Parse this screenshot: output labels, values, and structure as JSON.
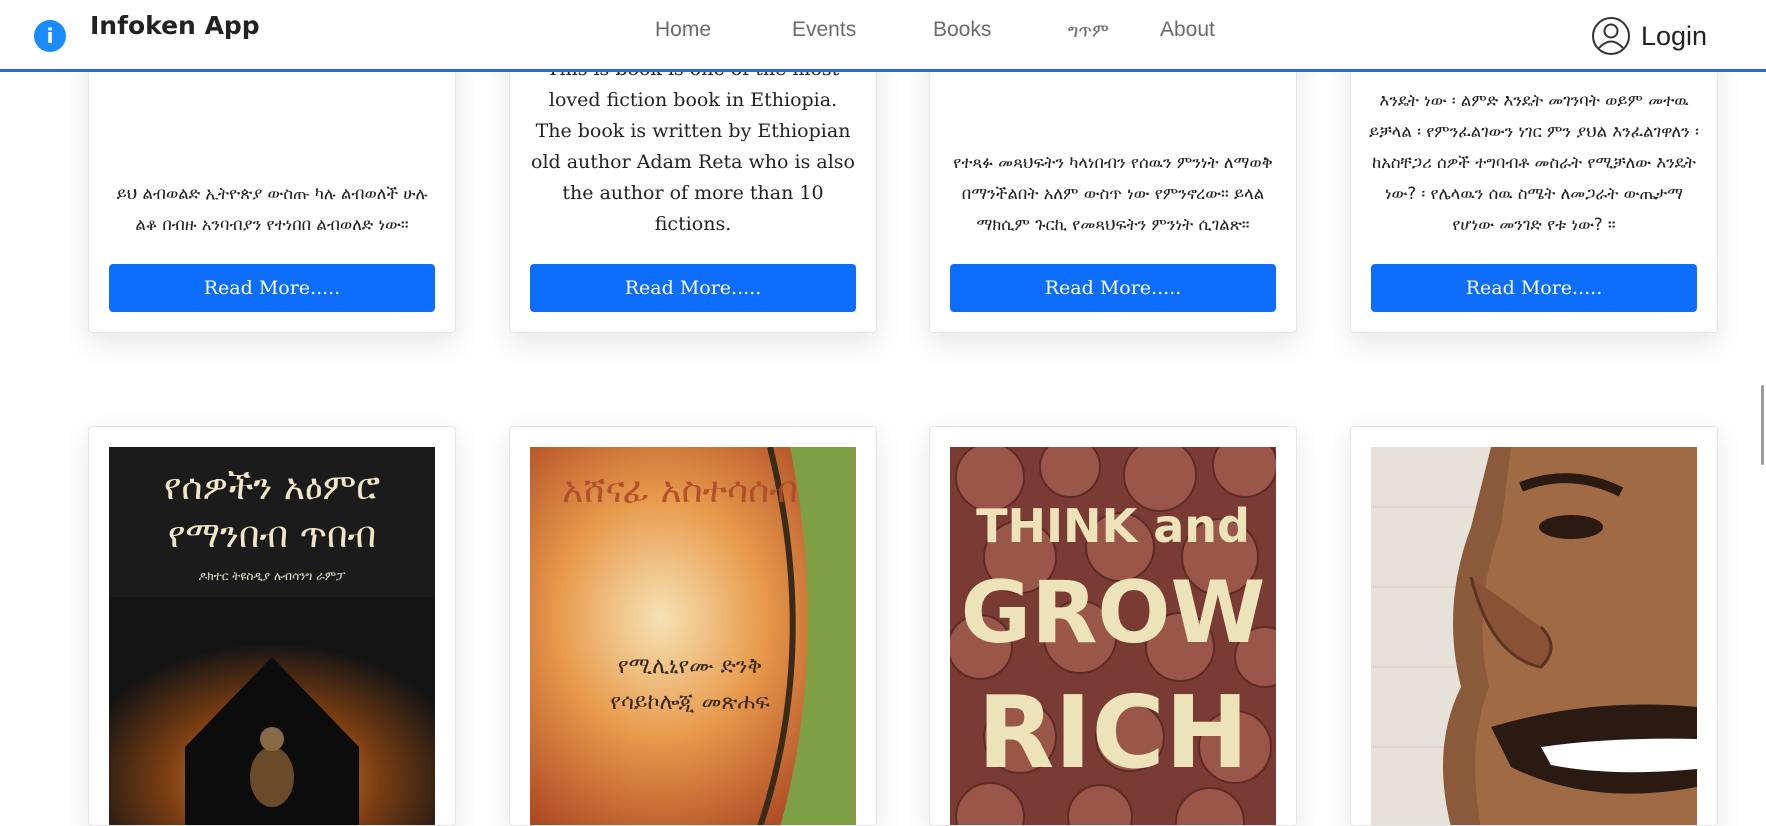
{
  "navbar": {
    "brand": "Infoken App",
    "links": [
      "Home",
      "Events",
      "Books",
      "ግጥም",
      "About"
    ],
    "login_label": "Login"
  },
  "colors": {
    "accent": "#0d6efd",
    "navbar_border": "#1f6fe0"
  },
  "row1_cards": [
    {
      "description": "ይህ ልብወልድ ኢትዮጵያ ውስጡ ካሉ ልብወለች ሁሉ ልቆ በብዙ አንባብያን የተነበበ ልብወለድ ነው።",
      "button_label": "Read More....."
    },
    {
      "description": "This is book is one of the most loved fiction book in Ethiopia. The book is written by Ethiopian old author Adam Reta who is also the author of more than 10 fictions.",
      "button_label": "Read More....."
    },
    {
      "description": "የተጻፉ መጻህፍትን ካላነበብን የሰዉን ምንነት ለማወቅ በማንችልበት አለም ውስጥ ነው የምንኖረው። ይላል ማክሲም ጉርኪ የመጻህፍትን ምንነት ሲገልጽ።",
      "button_label": "Read More....."
    },
    {
      "description": "እንዴት ነው ፡ ልምድ እንዴት መገንባት ወይም መተዉ ይቻላል ፡ የምንፈልገውን ነገር ምን ያህል እንፈልገዋለን ፡ ከአስቸጋሪ ሰዎች ተግባብቶ መስራት የሚቻለው እንዴት ነው? ፡ የሌላዉን ሰዉ ስሜት ለመጋራት ውጤታማ የሆነው መንገድ የቱ ነው? ።",
      "button_label": "Read More....."
    }
  ],
  "row2_cards": [
    {
      "cover_lines": [
        "የሰዎችን አዕምሮ",
        "የማንበብ ጥበብ"
      ],
      "cover_subtitle": "ዶክተር ትዩስዲያ ሉብሳንግ ራምፓ",
      "cover_icon": "book-cover-mystic-figure"
    },
    {
      "cover_lines": [
        "አሸናፊ አስተሳሰብ"
      ],
      "cover_subtitle_lines": [
        "የሚሊኒየሙ ድንቅ",
        "የሳይኮሎጂ መጽሐፍ"
      ],
      "cover_icon": "book-cover-sunburst"
    },
    {
      "cover_lines": [
        "THINK and",
        "GROW",
        "RICH"
      ],
      "cover_icon": "book-cover-coins"
    },
    {
      "cover_icon": "book-cover-smiling-face"
    }
  ]
}
